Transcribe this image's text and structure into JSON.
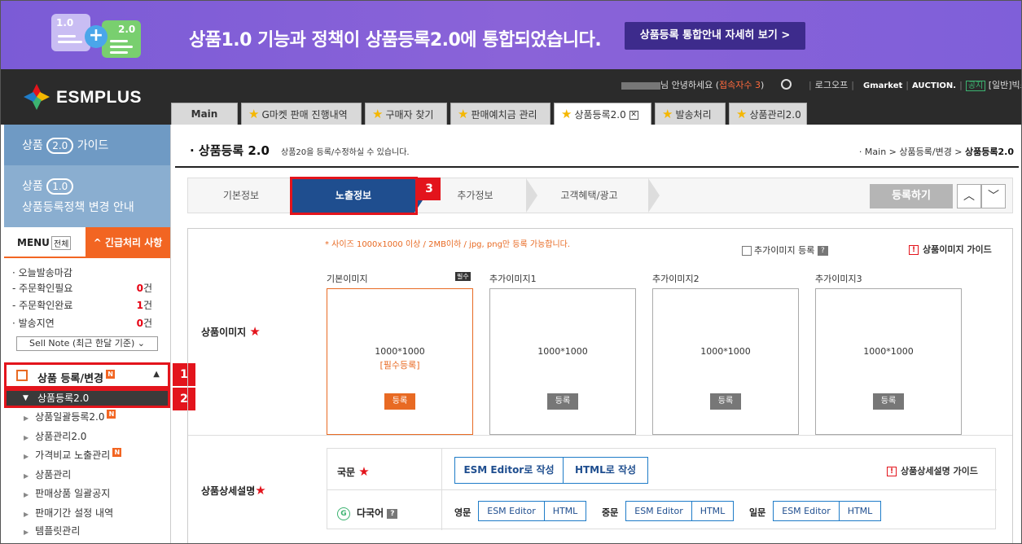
{
  "banner": {
    "doc1_label": "1.0",
    "doc2_label": "2.0",
    "plus": "+",
    "message": "상품1.0 기능과 정책이 상품등록2.0에 통합되었습니다.",
    "button": "상품등록 통합안내 자세히 보기 >"
  },
  "header": {
    "logo_text": "ESMPLUS",
    "greeting_suffix": "님 안녕하세요 (",
    "access_count": "접속자수 3",
    "greeting_close": ")",
    "logout": "로그오프",
    "gmarket": "Gmarket",
    "auction": "AUCTION.",
    "notice_tag": "공지",
    "notice_text": "[일반]빅스"
  },
  "tabs": [
    {
      "label": "Main",
      "star": false,
      "active": false
    },
    {
      "label": "G마켓 판매 진행내역",
      "star": true,
      "active": false
    },
    {
      "label": "구매자 찾기",
      "star": true,
      "active": false
    },
    {
      "label": "판매예치금 관리",
      "star": true,
      "active": false
    },
    {
      "label": "상품등록2.0",
      "star": true,
      "active": true,
      "close": "✕"
    },
    {
      "label": "발송처리",
      "star": true,
      "active": false
    },
    {
      "label": "상품관리2.0",
      "star": true,
      "active": false
    }
  ],
  "sidebar": {
    "guide1_pre": "상품",
    "guide1_pill": "2.0",
    "guide1_post": "가이드",
    "guide2_pre": "상품",
    "guide2_pill": "1.0",
    "guide2_line2": "상품등록정책 변경 안내",
    "menu_title": "MENU",
    "menu_all": "전체",
    "urgent": "^ 긴급처리 사항",
    "stats": [
      {
        "label": "· 오늘발송마감",
        "value": "",
        "unit": ""
      },
      {
        "label": "- 주문확인필요",
        "value": "0",
        "unit": "건"
      },
      {
        "label": "- 주문확인완료",
        "value": "1",
        "unit": "건"
      },
      {
        "label": "· 발송지연",
        "value": "0",
        "unit": "건"
      }
    ],
    "sell_note": "Sell Note (최근 한달 기준) ⌄",
    "section_label": "상품 등록/변경",
    "section_badge": "N",
    "current_item": "상품등록2.0",
    "items": [
      {
        "label": "상품일괄등록2.0",
        "badge": "N"
      },
      {
        "label": "상품관리2.0",
        "badge": ""
      },
      {
        "label": "가격비교 노출관리",
        "badge": "N"
      },
      {
        "label": "상품관리",
        "badge": ""
      },
      {
        "label": "판매상품 일괄공지",
        "badge": ""
      },
      {
        "label": "판매기간 설정 내역",
        "badge": ""
      },
      {
        "label": "템플릿관리",
        "badge": ""
      }
    ],
    "markers": [
      "1",
      "2"
    ]
  },
  "page": {
    "title": "· 상품등록 2.0",
    "desc": "상품20을 등록/수정하실 수 있습니다.",
    "breadcrumb_pre": "· Main > 상품등록/변경 > ",
    "breadcrumb_cur": "상품등록2.0"
  },
  "steps": [
    "기본정보",
    "노출정보",
    "추가정보",
    "고객혜택/광고"
  ],
  "step_marker": "3",
  "register_button": "등록하기",
  "image_section": {
    "label": "상품이미지",
    "hint": "* 사이즈 1000x1000 이상 / 2MB이하 / jpg, png만 등록 가능합니다.",
    "extra_check": "추가이미지 등록",
    "guide": "상품이미지 가이드",
    "required_tag": "필수",
    "boxes": [
      {
        "title": "기본이미지",
        "size": "1000*1000",
        "note": "[필수등록]",
        "button": "등록"
      },
      {
        "title": "추가이미지1",
        "size": "1000*1000",
        "note": "",
        "button": "등록"
      },
      {
        "title": "추가이미지2",
        "size": "1000*1000",
        "note": "",
        "button": "등록"
      },
      {
        "title": "추가이미지3",
        "size": "1000*1000",
        "note": "",
        "button": "등록"
      }
    ]
  },
  "detail_section": {
    "label": "상품상세설명",
    "domestic": "국문",
    "multi": "다국어",
    "esm_btn": "ESM Editor로 작성",
    "html_btn": "HTML로 작성",
    "guide": "상품상세설명 가이드",
    "languages": [
      {
        "name": "영문",
        "esm": "ESM Editor",
        "html": "HTML"
      },
      {
        "name": "중문",
        "esm": "ESM Editor",
        "html": "HTML"
      },
      {
        "name": "일문",
        "esm": "ESM Editor",
        "html": "HTML"
      }
    ]
  }
}
